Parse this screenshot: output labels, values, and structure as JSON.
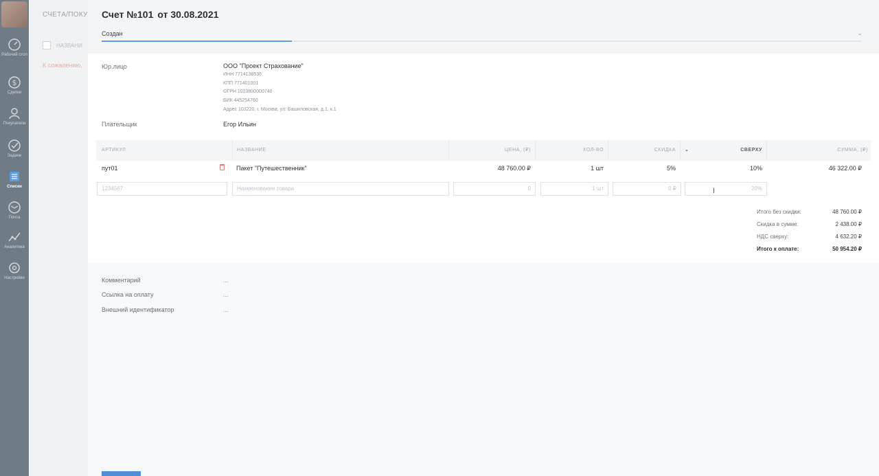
{
  "sidebar": {
    "items": [
      {
        "label": "Рабочий стол",
        "icon": "speedometer-icon"
      },
      {
        "label": "Сделки",
        "icon": "dollar-icon"
      },
      {
        "label": "Покупатели",
        "icon": "person-icon"
      },
      {
        "label": "Задачи",
        "icon": "checkmark-icon"
      },
      {
        "label": "Списки",
        "icon": "list-icon"
      },
      {
        "label": "Почта",
        "icon": "mail-icon"
      },
      {
        "label": "Аналитика",
        "icon": "chart-icon"
      },
      {
        "label": "Настройки",
        "icon": "gear-icon"
      }
    ],
    "active_index": 4
  },
  "background_page": {
    "breadcrumb": "СЧЕТА/ПОКУ",
    "column_header": "НАЗВАНИ",
    "error_text": "К сожалению,"
  },
  "invoice": {
    "title": "Счет №101",
    "date": "от 30.08.2021",
    "status": "Создан",
    "progress": 0.25,
    "legal_entity_label": "Юр.лицо",
    "legal_entity": {
      "name": "ООО \"Проект Страхование\"",
      "inn": "ИНН 7714138536",
      "kpp": "КПП 771401001",
      "ogrn": "ОГРН 1023800000740",
      "bik": "БИК 445254760",
      "address": "Адрес 103220, г. Москва, ул. Башиловская, д.1, к.1"
    },
    "payer_label": "Плательщик",
    "payer": "Егор Ильин",
    "table": {
      "headers": {
        "article": "АРТИКУЛ",
        "name": "НАЗВАНИЕ",
        "price": "ЦЕНА, (₽)",
        "qty": "КОЛ-ВО",
        "discount": "СКИДКА",
        "markup_toggle": "⌄",
        "markup": "СВЕРХУ",
        "sum": "СУММА, (₽)"
      },
      "rows": [
        {
          "article": "пут01",
          "name": "Пакет \"Путешественник\"",
          "price": "48 760.00 ₽",
          "qty": "1 шт",
          "discount": "5%",
          "markup": "10%",
          "sum": "46 322.00 ₽"
        }
      ],
      "new_row": {
        "article_placeholder": "1234567",
        "name_placeholder": "Наименование товара",
        "price_placeholder": "0",
        "qty_placeholder": "1 шт",
        "discount_placeholder": "0 ₽",
        "markup_placeholder": "20%"
      }
    },
    "totals": {
      "subtotal_label": "Итого без скидки:",
      "subtotal": "48 760.00 ₽",
      "discount_label": "Скидка в сумме:",
      "discount": "2 438.00 ₽",
      "vat_label": "НДС сверху:",
      "vat": "4 632.20 ₽",
      "total_label": "Итого к оплате:",
      "total": "50 954.20 ₽"
    },
    "meta": {
      "comment_label": "Комментарий",
      "comment": "...",
      "payment_link_label": "Ссылка на оплату",
      "payment_link": "...",
      "external_id_label": "Внешний идентификатор",
      "external_id": "..."
    }
  },
  "colors": {
    "accent": "#5c9ce0",
    "sidebar": "#6f7b85",
    "danger": "#e87878"
  }
}
